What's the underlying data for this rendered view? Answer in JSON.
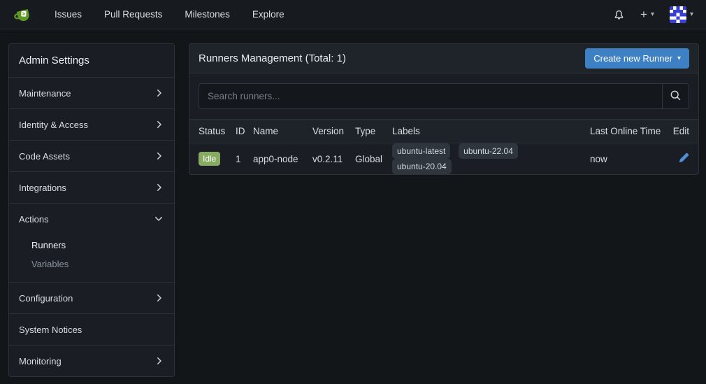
{
  "colors": {
    "accent_blue": "#3d80c4",
    "status_green": "#87ab63",
    "edit_link_blue": "#4f90d5"
  },
  "icons": {
    "plus": "+",
    "caret_down": "▾"
  },
  "navbar": {
    "links": [
      {
        "label": "Issues"
      },
      {
        "label": "Pull Requests"
      },
      {
        "label": "Milestones"
      },
      {
        "label": "Explore"
      }
    ]
  },
  "sidebar": {
    "title": "Admin Settings",
    "items": [
      {
        "label": "Maintenance"
      },
      {
        "label": "Identity & Access"
      },
      {
        "label": "Code Assets"
      },
      {
        "label": "Integrations"
      },
      {
        "label": "Actions",
        "expanded": true,
        "children": [
          {
            "label": "Runners",
            "active": true
          },
          {
            "label": "Variables",
            "active": false
          }
        ]
      },
      {
        "label": "Configuration"
      },
      {
        "label": "System Notices"
      },
      {
        "label": "Monitoring"
      }
    ]
  },
  "main": {
    "header": {
      "title": "Runners Management (Total: 1)",
      "create_button_label": "Create new Runner"
    },
    "search": {
      "placeholder": "Search runners..."
    },
    "table": {
      "columns": [
        "Status",
        "ID",
        "Name",
        "Version",
        "Type",
        "Labels",
        "Last Online Time",
        "Edit"
      ],
      "rows": [
        {
          "status": "Idle",
          "id": "1",
          "name": "app0-node",
          "version": "v0.2.11",
          "type": "Global",
          "labels": [
            "ubuntu-latest",
            "ubuntu-22.04",
            "ubuntu-20.04"
          ],
          "last_online": "now"
        }
      ]
    }
  }
}
